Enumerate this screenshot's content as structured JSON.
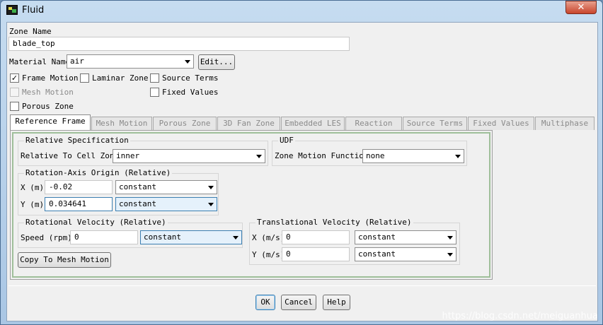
{
  "window": {
    "title": "Fluid",
    "close_symbol": "✕"
  },
  "zone": {
    "label": "Zone Name",
    "value": "blade_top"
  },
  "material": {
    "label": "Material Name",
    "value": "air",
    "edit_label": "Edit..."
  },
  "options": {
    "frame_motion": {
      "label": "Frame Motion",
      "checked": true,
      "mark": "✓"
    },
    "laminar_zone": {
      "label": "Laminar Zone",
      "checked": false
    },
    "source_terms": {
      "label": "Source Terms",
      "checked": false
    },
    "mesh_motion": {
      "label": "Mesh Motion",
      "checked": false,
      "disabled": true
    },
    "fixed_values": {
      "label": "Fixed Values",
      "checked": false
    },
    "porous_zone": {
      "label": "Porous Zone",
      "checked": false
    }
  },
  "tabs": [
    {
      "label": "Reference Frame",
      "active": true
    },
    {
      "label": "Mesh Motion"
    },
    {
      "label": "Porous Zone"
    },
    {
      "label": "3D Fan Zone"
    },
    {
      "label": "Embedded LES"
    },
    {
      "label": "Reaction"
    },
    {
      "label": "Source Terms"
    },
    {
      "label": "Fixed Values"
    },
    {
      "label": "Multiphase"
    }
  ],
  "relative_spec": {
    "title": "Relative Specification",
    "label": "Relative To Cell Zone",
    "value": "inner"
  },
  "udf": {
    "title": "UDF",
    "label": "Zone Motion Function",
    "value": "none"
  },
  "rotation_origin": {
    "title": "Rotation-Axis Origin (Relative)",
    "x_label": "X (m)",
    "x_value": "-0.02",
    "x_profile": "constant",
    "y_label": "Y (m)",
    "y_value": "0.034641",
    "y_profile": "constant"
  },
  "rotational_velocity": {
    "title": "Rotational Velocity (Relative)",
    "speed_label": "Speed (rpm)",
    "speed_value": "0",
    "speed_profile": "constant"
  },
  "translational_velocity": {
    "title": "Translational Velocity (Relative)",
    "x_label": "X (m/s)",
    "x_value": "0",
    "x_profile": "constant",
    "y_label": "Y (m/s)",
    "y_value": "0",
    "y_profile": "constant"
  },
  "copy_button": "Copy To Mesh Motion",
  "footer": {
    "ok": "OK",
    "cancel": "Cancel",
    "help": "Help"
  },
  "watermark": "https://blog.csdn.net/meiguanhua"
}
